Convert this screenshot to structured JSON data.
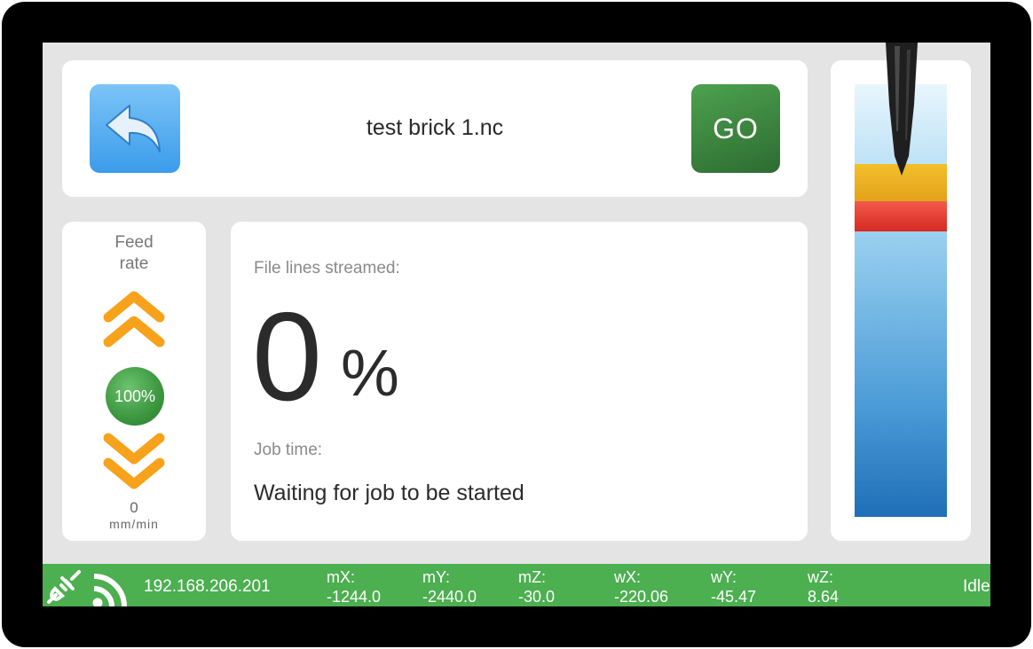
{
  "header": {
    "file_name": "test brick 1.nc",
    "go_label": "GO",
    "back_icon": "back-arrow-icon"
  },
  "feed": {
    "title_line1": "Feed",
    "title_line2": "rate",
    "override_pct": "100%",
    "value": "0",
    "unit": "mm/min",
    "up_icon": "double-chevron-up-icon",
    "down_icon": "double-chevron-down-icon"
  },
  "progress": {
    "lines_label": "File lines streamed:",
    "percent": "0",
    "percent_sign": "%",
    "job_time_label": "Job time:",
    "job_time_value": "Waiting for job to be started"
  },
  "status": {
    "ip": "192.168.206.201",
    "state": "Idle",
    "coords": [
      {
        "label": "mX:",
        "value": "-1244.0"
      },
      {
        "label": "mY:",
        "value": "-2440.0"
      },
      {
        "label": "mZ:",
        "value": "-30.0"
      },
      {
        "label": "wX:",
        "value": "-220.06"
      },
      {
        "label": "wY:",
        "value": "-45.47"
      },
      {
        "label": "wZ:",
        "value": "8.64"
      }
    ]
  },
  "colors": {
    "status_green": "#4caf50",
    "go_green": "#3a8a3d",
    "back_blue": "#4aa5ee",
    "chevron_orange": "#f7a21b",
    "zone_yellow": "#eab023",
    "zone_red": "#e63a2e"
  }
}
